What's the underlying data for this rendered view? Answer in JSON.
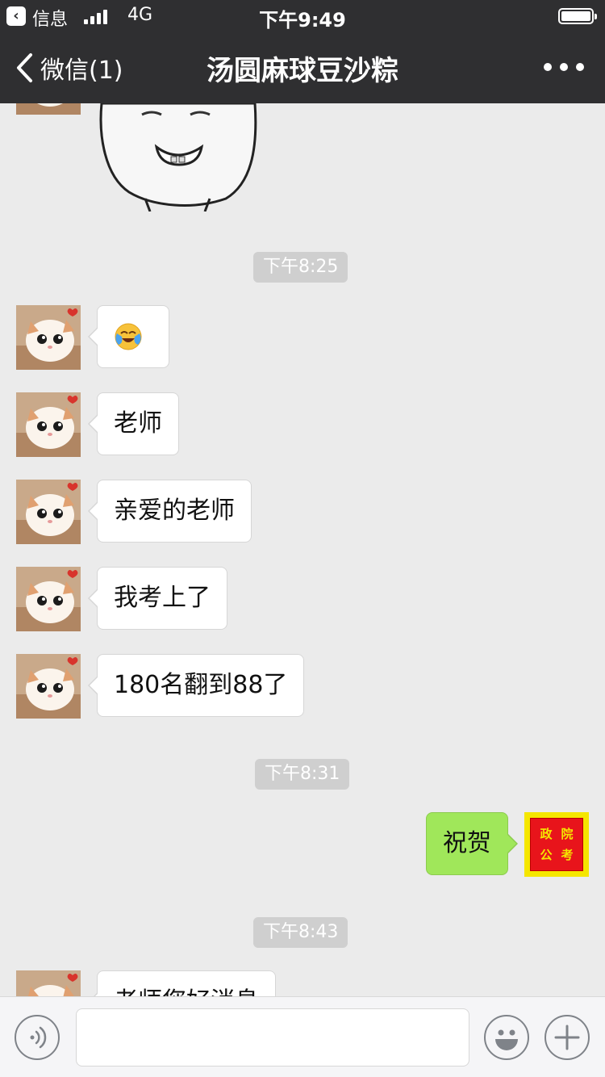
{
  "status_bar": {
    "back_app": "信息",
    "network": "4G",
    "time": "下午9:49"
  },
  "nav": {
    "back_label": "微信(1)",
    "title": "汤圆麻球豆沙粽"
  },
  "messages": {
    "ts1": "下午8:25",
    "m2": "老师",
    "m3": "亲爱的老师",
    "m4": "我考上了",
    "m5": "180名翻到88了",
    "ts2": "下午8:31",
    "reply": "祝贺",
    "ts3": "下午8:43",
    "partial": "老师您好消息"
  },
  "my_avatar": {
    "chars": [
      "政",
      "院",
      "公",
      "考"
    ]
  },
  "colors": {
    "bar": "#2f2f31",
    "chat_bg": "#ebebeb",
    "out_bubble": "#a0e75a",
    "avatar_red": "#e8141b",
    "avatar_yellow": "#f5e600"
  },
  "icons": [
    "back-chevron-icon",
    "more-icon",
    "voice-icon",
    "emoji-icon",
    "plus-icon",
    "cry-laugh-emoji"
  ]
}
